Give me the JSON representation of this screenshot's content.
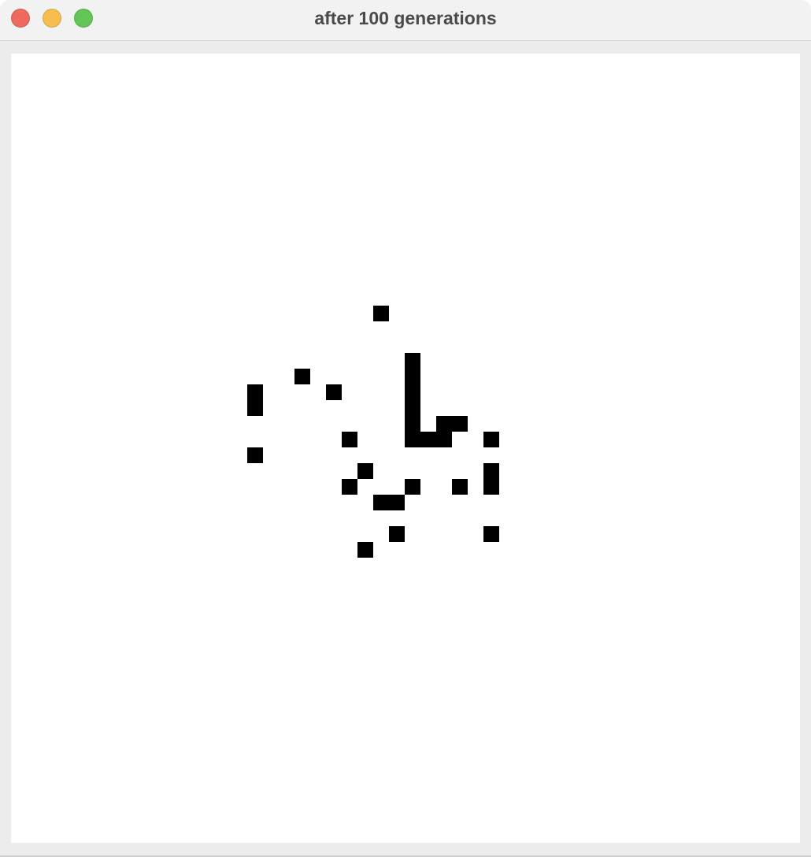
{
  "window": {
    "title": "after 100 generations",
    "controls": {
      "close_color": "#ee6a5f",
      "minimize_color": "#f5be4f",
      "zoom_color": "#62c555"
    }
  },
  "grid": {
    "cell_color": "#000000",
    "background_color": "#ffffff",
    "live_cells": [
      {
        "col": 23,
        "row": 16
      },
      {
        "col": 25,
        "row": 19
      },
      {
        "col": 25,
        "row": 20
      },
      {
        "col": 25,
        "row": 21
      },
      {
        "col": 25,
        "row": 22
      },
      {
        "col": 25,
        "row": 23
      },
      {
        "col": 25,
        "row": 24
      },
      {
        "col": 26,
        "row": 24
      },
      {
        "col": 27,
        "row": 24
      },
      {
        "col": 27,
        "row": 23
      },
      {
        "col": 28,
        "row": 23
      },
      {
        "col": 18,
        "row": 20
      },
      {
        "col": 20,
        "row": 21
      },
      {
        "col": 15,
        "row": 21
      },
      {
        "col": 15,
        "row": 22
      },
      {
        "col": 21,
        "row": 24
      },
      {
        "col": 30,
        "row": 24
      },
      {
        "col": 15,
        "row": 25
      },
      {
        "col": 22,
        "row": 26
      },
      {
        "col": 30,
        "row": 26
      },
      {
        "col": 30,
        "row": 27
      },
      {
        "col": 21,
        "row": 27
      },
      {
        "col": 25,
        "row": 27
      },
      {
        "col": 28,
        "row": 27
      },
      {
        "col": 23,
        "row": 28
      },
      {
        "col": 24,
        "row": 28
      },
      {
        "col": 24,
        "row": 30
      },
      {
        "col": 30,
        "row": 30
      },
      {
        "col": 22,
        "row": 31
      }
    ]
  }
}
